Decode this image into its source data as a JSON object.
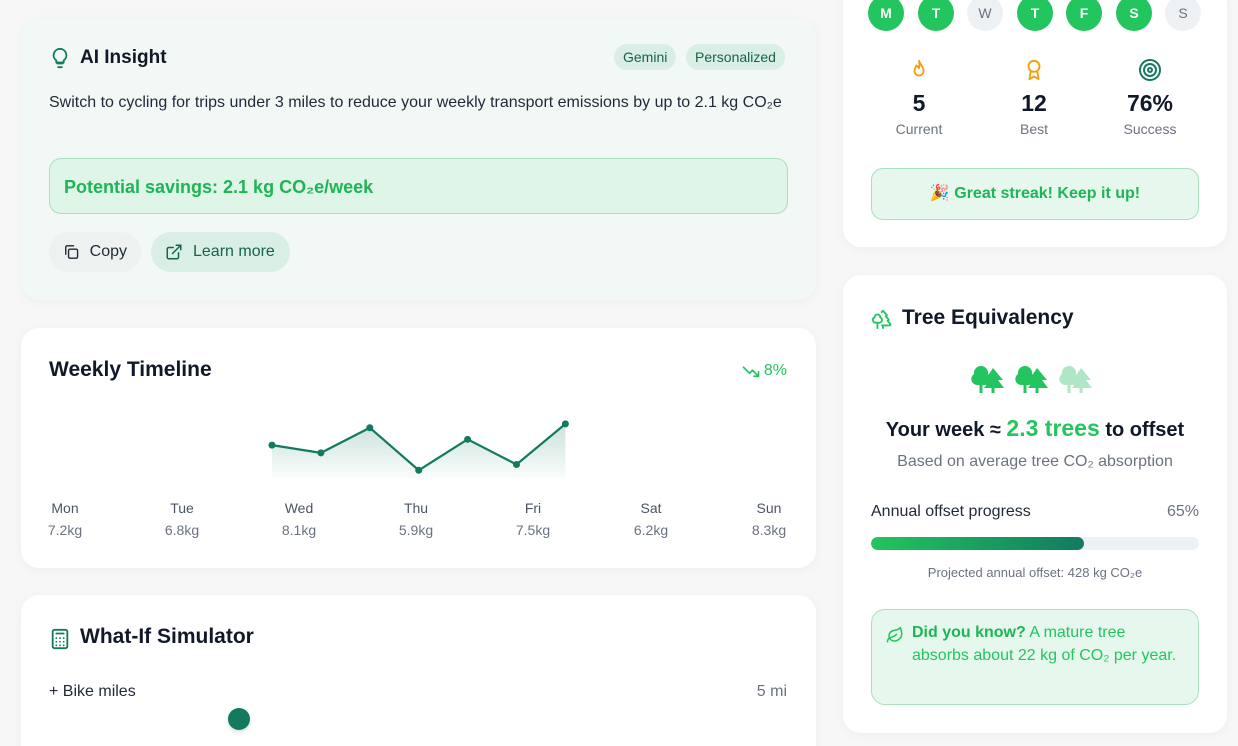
{
  "insight": {
    "title": "AI Insight",
    "badges": [
      "Gemini",
      "Personalized"
    ],
    "text": "Switch to cycling for trips under 3 miles to reduce your weekly transport emissions by up to 2.1 kg CO₂e",
    "savings": "Potential savings: 2.1 kg CO₂e/week",
    "copy_label": "Copy",
    "learn_label": "Learn more"
  },
  "timeline": {
    "title": "Weekly Timeline",
    "trend": "8%",
    "days": [
      {
        "name": "Mon",
        "value": "7.2kg"
      },
      {
        "name": "Tue",
        "value": "6.8kg"
      },
      {
        "name": "Wed",
        "value": "8.1kg"
      },
      {
        "name": "Thu",
        "value": "5.9kg"
      },
      {
        "name": "Fri",
        "value": "7.5kg"
      },
      {
        "name": "Sat",
        "value": "6.2kg"
      },
      {
        "name": "Sun",
        "value": "8.3kg"
      }
    ]
  },
  "chart_data": {
    "type": "area",
    "categories": [
      "Mon",
      "Tue",
      "Wed",
      "Thu",
      "Fri",
      "Sat",
      "Sun"
    ],
    "values": [
      7.2,
      6.8,
      8.1,
      5.9,
      7.5,
      6.2,
      8.3
    ],
    "title": "Weekly Timeline",
    "xlabel": "",
    "ylabel": "",
    "grid": false,
    "color": "#137a60"
  },
  "whatif": {
    "title": "What-If Simulator",
    "label": "+ Bike miles",
    "value": "5 mi"
  },
  "streak": {
    "days": [
      {
        "letter": "M",
        "active": true
      },
      {
        "letter": "T",
        "active": true
      },
      {
        "letter": "W",
        "active": false
      },
      {
        "letter": "T",
        "active": true
      },
      {
        "letter": "F",
        "active": true
      },
      {
        "letter": "S",
        "active": true
      },
      {
        "letter": "S",
        "active": false
      }
    ],
    "stats": [
      {
        "value": "5",
        "label": "Current",
        "icon": "flame-icon"
      },
      {
        "value": "12",
        "label": "Best",
        "icon": "award-icon"
      },
      {
        "value": "76%",
        "label": "Success",
        "icon": "target-icon"
      }
    ],
    "message": "🎉 Great streak! Keep it up!"
  },
  "tree": {
    "title": "Tree Equivalency",
    "line_prefix": "Your week ≈ ",
    "line_num": "2.3 trees",
    "line_suffix": " to offset",
    "sub": "Based on average tree CO₂ absorption",
    "progress_label": "Annual offset progress",
    "progress_pct": "65%",
    "progress": 0.65,
    "projected": "Projected annual offset: 428 kg CO₂e",
    "know_bold": "Did you know?",
    "know_text": " A mature tree absorbs about 22 kg of CO₂ per year."
  },
  "colors": {
    "accent": "#22c55e",
    "primary": "#137a60",
    "badge_bg": "#d9eee5"
  }
}
